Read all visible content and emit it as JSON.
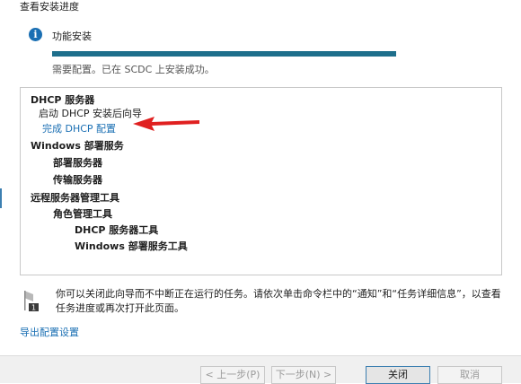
{
  "section_title": "查看安装进度",
  "progress": {
    "icon": "info-icon",
    "label": "功能安装",
    "percent": 100,
    "status": "需要配置。已在 SCDC 上安装成功。",
    "color": "#1e6f8c"
  },
  "results": {
    "dhcp_title": "DHCP 服务器",
    "dhcp_wizard": "启动 DHCP 安装后向导",
    "dhcp_complete_link": "完成 DHCP 配置",
    "wds_title": "Windows 部署服务",
    "wds_deploy": "部署服务器",
    "wds_transport": "传输服务器",
    "rsat_title": "远程服务器管理工具",
    "role_tools": "角色管理工具",
    "dhcp_tools": "DHCP 服务器工具",
    "wds_tools": "Windows 部署服务工具"
  },
  "note": {
    "icon": "flag-icon",
    "text": "你可以关闭此向导而不中断正在运行的任务。请依次单击命令栏中的“通知”和“任务详细信息”，以查看任务进度或再次打开此页面。"
  },
  "export_link": "导出配置设置",
  "buttons": {
    "prev": "< 上一步(P)",
    "next": "下一步(N) >",
    "close": "关闭",
    "cancel": "取消"
  }
}
